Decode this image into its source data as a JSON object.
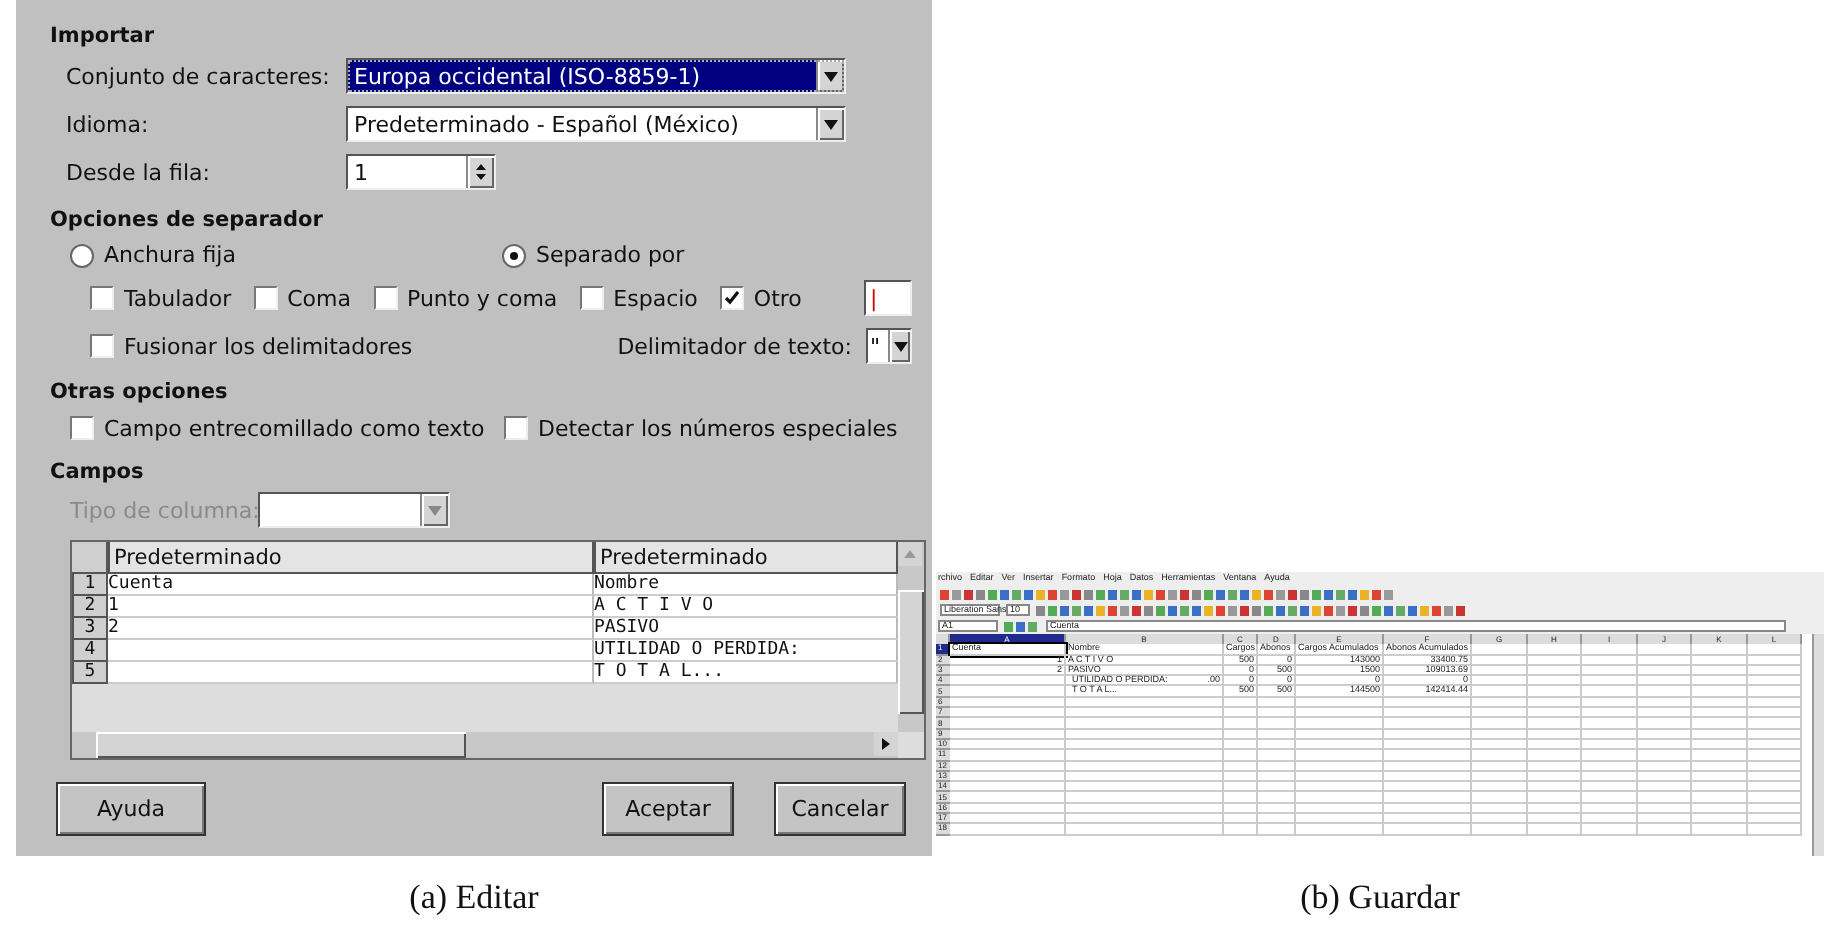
{
  "dialog": {
    "import": {
      "title": "Importar",
      "fields": [
        {
          "kind": "select",
          "label": "Conjunto de caracteres:",
          "value": "Europa occidental (ISO-8859-1)",
          "focused": true
        },
        {
          "kind": "select",
          "label": "Idioma:",
          "value": "Predeterminado - Español (México)",
          "focused": false
        },
        {
          "kind": "spin",
          "label": "Desde la fila:",
          "value": "1",
          "focused": false
        }
      ]
    },
    "separator": {
      "title": "Opciones de separador",
      "modes": [
        {
          "label": "Anchura fija",
          "selected": false
        },
        {
          "label": "Separado por",
          "selected": true
        }
      ],
      "delimiters": [
        {
          "label": "Tabulador",
          "checked": false
        },
        {
          "label": "Coma",
          "checked": false
        },
        {
          "label": "Punto y coma",
          "checked": false
        },
        {
          "label": "Espacio",
          "checked": false
        },
        {
          "label": "Otro",
          "checked": true
        }
      ],
      "other_value": "|",
      "merge": {
        "label": "Fusionar los delimitadores",
        "checked": false
      },
      "text_delimiter": {
        "label": "Delimitador de texto:",
        "value": "\""
      }
    },
    "other_options": {
      "title": "Otras opciones",
      "options": [
        {
          "label": "Campo entrecomillado como texto",
          "checked": false
        },
        {
          "label": "Detectar los números especiales",
          "checked": false
        }
      ]
    },
    "fields": {
      "title": "Campos",
      "column_type": {
        "label": "Tipo de columna:",
        "disabled": true
      },
      "preview": {
        "columns": [
          "Predeterminado",
          "Predeterminado"
        ],
        "rows": [
          {
            "number": "1",
            "cells": [
              "Cuenta",
              "Nombre"
            ]
          },
          {
            "number": "2",
            "cells": [
              "1",
              "A C T I V O"
            ]
          },
          {
            "number": "3",
            "cells": [
              "2",
              "PASIVO"
            ]
          },
          {
            "number": "4",
            "cells": [
              null,
              "UTILIDAD O PERDIDA:"
            ]
          },
          {
            "number": "5",
            "cells": [
              null,
              "T O T A L..."
            ]
          }
        ]
      }
    },
    "buttons": [
      {
        "label": "Ayuda"
      },
      {
        "label": "Aceptar"
      },
      {
        "label": "Cancelar"
      }
    ]
  },
  "spreadsheet": {
    "menu": [
      "rchivo",
      "Editar",
      "Ver",
      "Insertar",
      "Formato",
      "Hoja",
      "Datos",
      "Herramientas",
      "Ventana",
      "Ayuda"
    ],
    "font_name": "Liberation Sans",
    "font_size": "10",
    "cell_ref": "A1",
    "formula": "Cuenta",
    "columns": [
      {
        "label": "A",
        "selected": true
      },
      {
        "label": "B",
        "selected": false
      },
      {
        "label": "C",
        "selected": false
      },
      {
        "label": "D",
        "selected": false
      },
      {
        "label": "E",
        "selected": false
      },
      {
        "label": "F",
        "selected": false
      },
      {
        "label": "G",
        "selected": false
      },
      {
        "label": "H",
        "selected": false
      },
      {
        "label": "I",
        "selected": false
      },
      {
        "label": "J",
        "selected": false
      },
      {
        "label": "K",
        "selected": false
      },
      {
        "label": "L",
        "selected": false
      }
    ],
    "rows": [
      {
        "number": "1",
        "selected": true,
        "cells": [
          "Cuenta",
          "Nombre",
          "Cargos",
          "Abonos",
          "Cargos Acumulados",
          "Abonos Acumulados"
        ]
      },
      {
        "number": "2",
        "selected": false,
        "cells": [
          "1",
          "A C T I V O",
          "500",
          "0",
          "143000",
          "33400.75"
        ]
      },
      {
        "number": "3",
        "selected": false,
        "cells": [
          "2",
          "PASIVO",
          "0",
          "500",
          "1500",
          "109013.69"
        ]
      },
      {
        "number": "4",
        "selected": false,
        "cells": [
          null,
          "UTILIDAD O PERDIDA:",
          "0",
          "0",
          "0",
          "0"
        ],
        "overflow": ".00"
      },
      {
        "number": "5",
        "selected": false,
        "cells": [
          null,
          "T O T A L...",
          "500",
          "500",
          "144500",
          "142414.44"
        ]
      },
      {
        "number": "6",
        "selected": false
      },
      {
        "number": "7",
        "selected": false
      },
      {
        "number": "8",
        "selected": false
      },
      {
        "number": "9",
        "selected": false
      },
      {
        "number": "10",
        "selected": false
      },
      {
        "number": "11",
        "selected": false
      },
      {
        "number": "12",
        "selected": false
      },
      {
        "number": "13",
        "selected": false
      },
      {
        "number": "14",
        "selected": false
      },
      {
        "number": "15",
        "selected": false
      },
      {
        "number": "16",
        "selected": false
      },
      {
        "number": "17",
        "selected": false
      },
      {
        "number": "18",
        "selected": false
      }
    ]
  },
  "captions": [
    "(a) Editar",
    "(b) Guardar"
  ]
}
